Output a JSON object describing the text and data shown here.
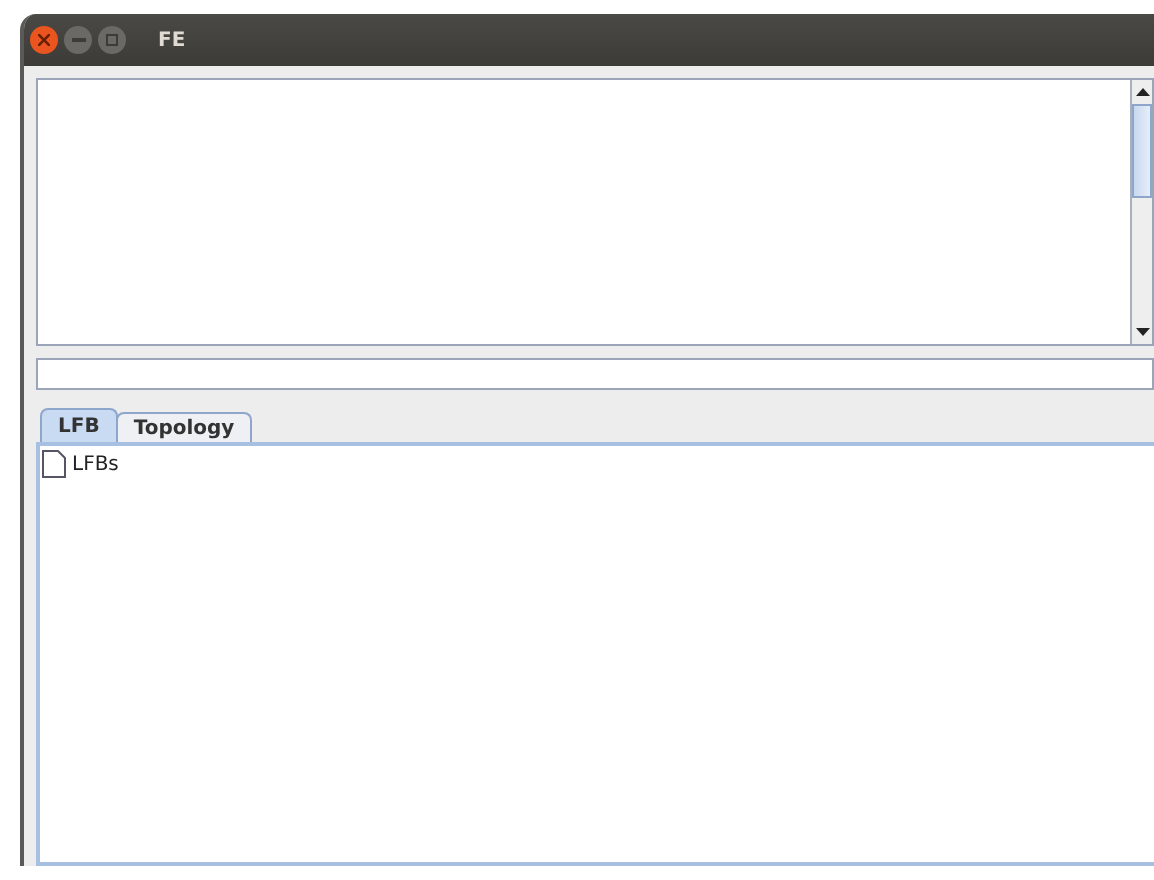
{
  "window": {
    "title": "FE"
  },
  "tabs": [
    {
      "label": "LFB",
      "selected": true
    },
    {
      "label": "Topology",
      "selected": false
    }
  ],
  "tree": {
    "items": [
      {
        "label": "LFBs"
      }
    ]
  }
}
